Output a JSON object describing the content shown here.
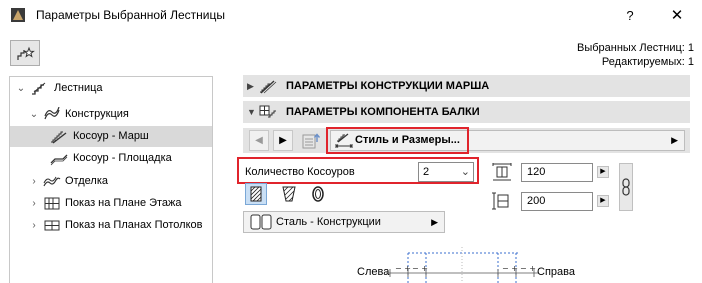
{
  "window": {
    "title": "Параметры Выбранной Лестницы",
    "help_glyph": "?",
    "close_glyph": "✕"
  },
  "selection_info": {
    "line1": "Выбранных Лестниц: 1",
    "line2": "Редактируемых: 1"
  },
  "tree": {
    "items": [
      {
        "label": "Лестница",
        "expander": "⌄",
        "icon": "stair-icon"
      },
      {
        "label": "Конструкция",
        "expander": "⌄",
        "icon": "structure-icon"
      },
      {
        "label": "Косоур - Марш",
        "expander": "",
        "icon": "stringer-flight-icon",
        "selected": true
      },
      {
        "label": "Косоур - Площадка",
        "expander": "",
        "icon": "stringer-landing-icon"
      },
      {
        "label": "Отделка",
        "expander": "›",
        "icon": "finish-icon"
      },
      {
        "label": "Показ на Плане Этажа",
        "expander": "›",
        "icon": "floor-plan-icon"
      },
      {
        "label": "Показ на Планах Потолков",
        "expander": "›",
        "icon": "ceiling-plan-icon"
      }
    ]
  },
  "sections": {
    "flight_structure": "ПАРАМЕТРЫ КОНСТРУКЦИИ МАРША",
    "beam_component": "ПАРАМЕТРЫ КОМПОНЕНТА БАЛКИ"
  },
  "controls": {
    "prev_glyph": "◀",
    "next_glyph": "▶",
    "style_label": "Стиль и Размеры...",
    "dropdown_arrow": "▶"
  },
  "stringer_count": {
    "label": "Количество Косоуров",
    "value": "2",
    "chevron": "⌄"
  },
  "dimensions": {
    "width": "120",
    "height": "200"
  },
  "material": {
    "label": "Сталь - Конструкции"
  },
  "diagram": {
    "left_label": "Слева",
    "right_label": "Справа"
  },
  "colors": {
    "highlight": "#e0242c",
    "selection": "#d9d9d9",
    "header_bg": "#e3e3e3",
    "blue_button": "#c9dff5"
  }
}
